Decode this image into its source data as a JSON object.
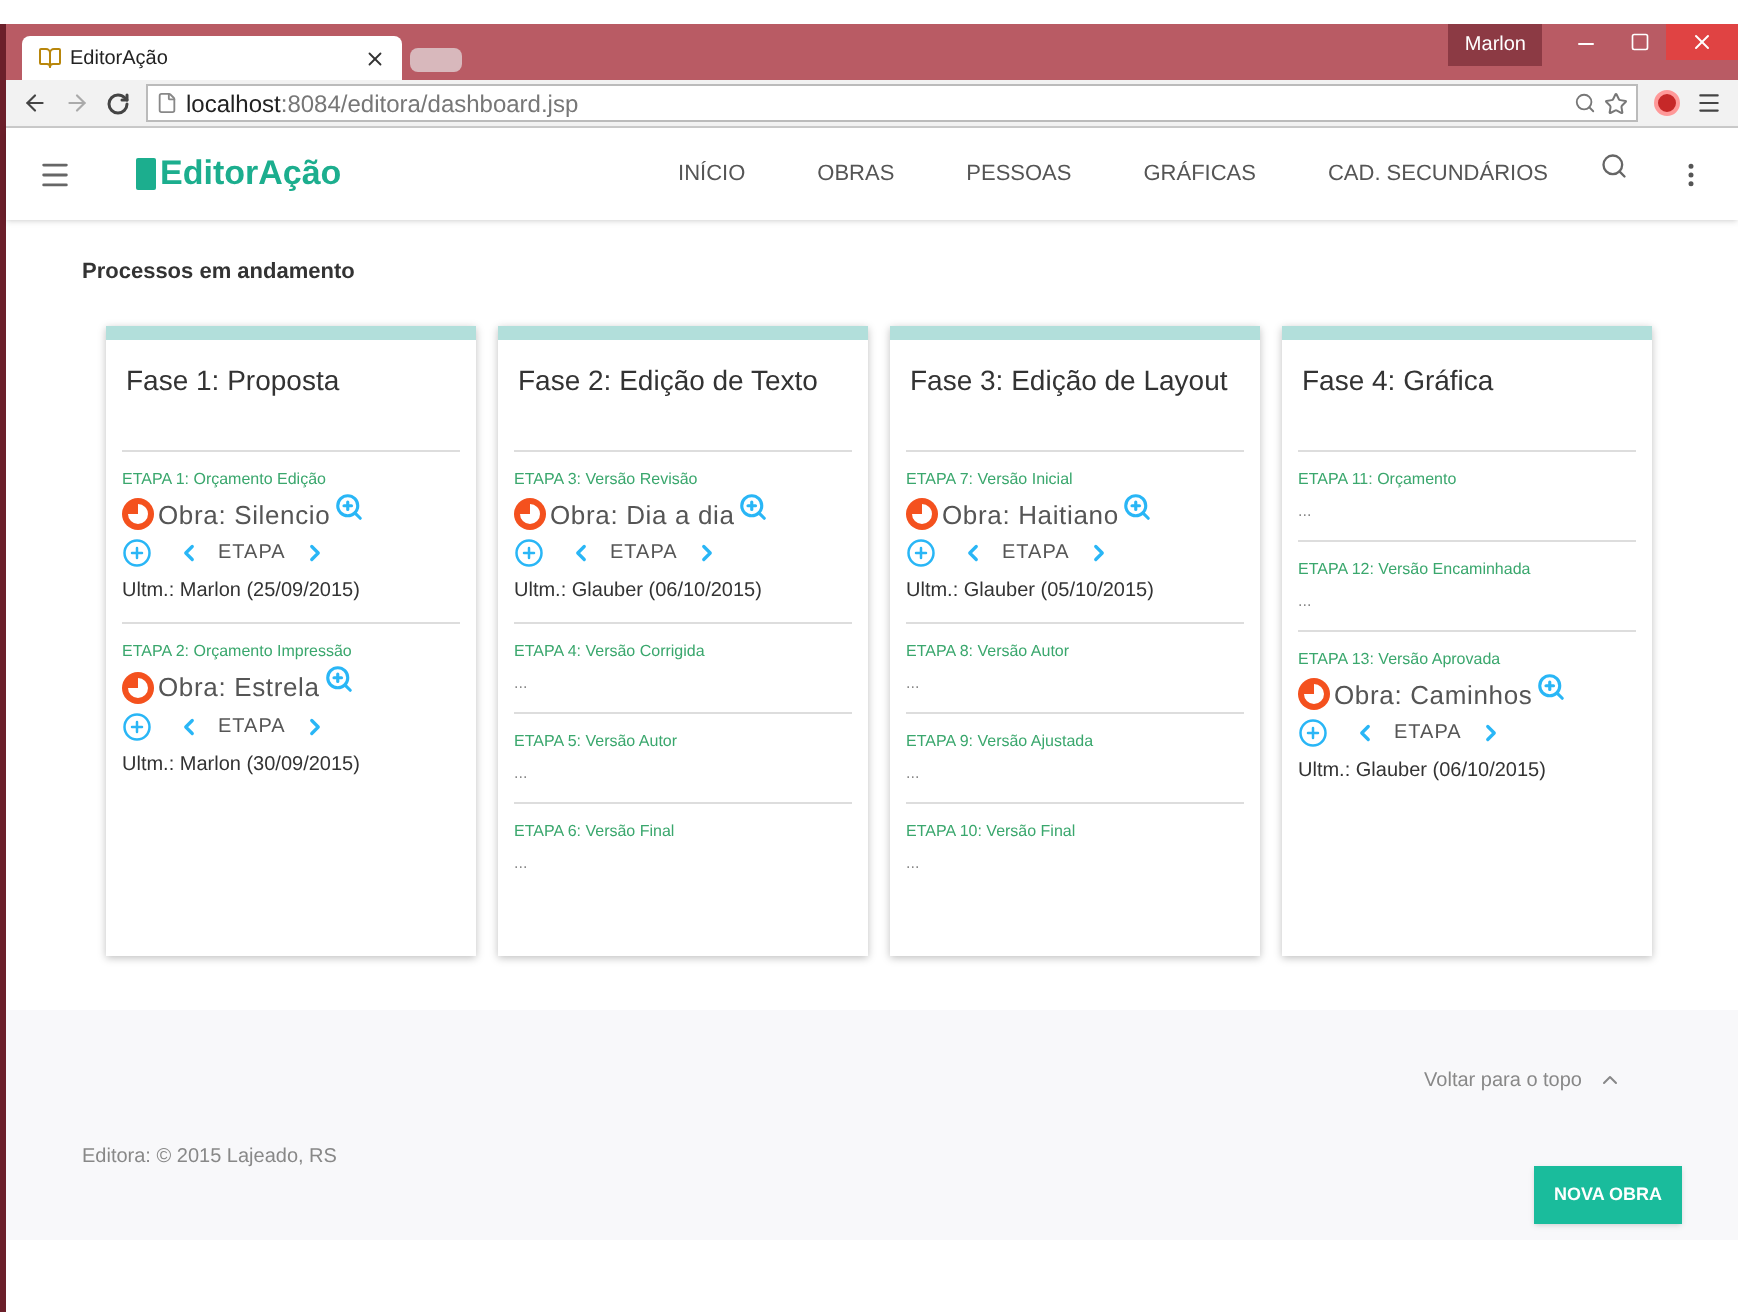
{
  "browser": {
    "tab_title": "EditorAção",
    "user": "Marlon",
    "url_host": "localhost",
    "url_rest": ":8084/editora/dashboard.jsp"
  },
  "app": {
    "logo": "EditorAção",
    "nav": [
      "INÍCIO",
      "OBRAS",
      "PESSOAS",
      "GRÁFICAS",
      "CAD. SECUNDÁRIOS"
    ]
  },
  "section_title": "Processos em andamento",
  "phases": [
    {
      "title": "Fase 1: Proposta",
      "etapas": [
        {
          "kind": "obra",
          "label": "ETAPA 1: Orçamento Edição",
          "obra": "Obra: Silencio",
          "nav": "ETAPA",
          "ultm": "Ultm.: Marlon (25/09/2015)"
        },
        {
          "kind": "obra",
          "label": "ETAPA 2: Orçamento Impressão",
          "obra": "Obra: Estrela",
          "nav": "ETAPA",
          "ultm": "Ultm.: Marlon (30/09/2015)"
        }
      ]
    },
    {
      "title": "Fase 2: Edição de Texto",
      "etapas": [
        {
          "kind": "obra",
          "label": "ETAPA 3: Versão Revisão",
          "obra": "Obra: Dia a dia",
          "nav": "ETAPA",
          "ultm": "Ultm.: Glauber (06/10/2015)"
        },
        {
          "kind": "empty",
          "label": "ETAPA 4: Versão Corrigida",
          "note": "..."
        },
        {
          "kind": "empty",
          "label": "ETAPA 5: Versão Autor",
          "note": "..."
        },
        {
          "kind": "empty",
          "label": "ETAPA 6: Versão Final",
          "note": "..."
        }
      ]
    },
    {
      "title": "Fase 3: Edição de Layout",
      "etapas": [
        {
          "kind": "obra",
          "label": "ETAPA 7: Versão Inicial",
          "obra": "Obra: Haitiano",
          "nav": "ETAPA",
          "ultm": "Ultm.: Glauber (05/10/2015)"
        },
        {
          "kind": "empty",
          "label": "ETAPA 8: Versão Autor",
          "note": "..."
        },
        {
          "kind": "empty",
          "label": "ETAPA 9: Versão Ajustada",
          "note": "..."
        },
        {
          "kind": "empty",
          "label": "ETAPA 10: Versão Final",
          "note": "..."
        }
      ]
    },
    {
      "title": "Fase 4: Gráfica",
      "etapas": [
        {
          "kind": "empty",
          "label": "ETAPA 11: Orçamento",
          "note": "..."
        },
        {
          "kind": "empty",
          "label": "ETAPA 12: Versão Encaminhada",
          "note": "..."
        },
        {
          "kind": "obra",
          "label": "ETAPA 13: Versão Aprovada",
          "obra": "Obra: Caminhos",
          "nav": "ETAPA",
          "ultm": "Ultm.: Glauber (06/10/2015)"
        }
      ]
    }
  ],
  "footer": {
    "back_to_top": "Voltar para o topo",
    "copyright": "Editora: © 2015 Lajeado, RS",
    "button": "NOVA OBRA"
  }
}
